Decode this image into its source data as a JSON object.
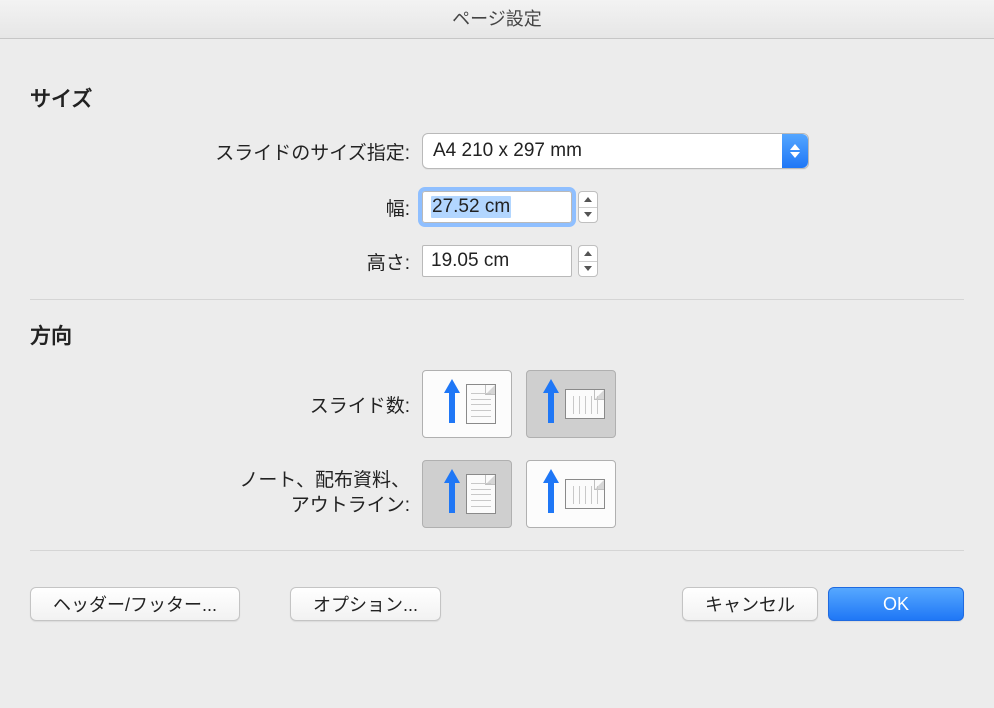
{
  "titlebar": "ページ設定",
  "sections": {
    "size": {
      "title": "サイズ",
      "slide_size_label": "スライドのサイズ指定:",
      "slide_size_value": "A4 210 x 297 mm",
      "width_label": "幅:",
      "width_value": "27.52 cm",
      "height_label": "高さ:",
      "height_value": "19.05 cm"
    },
    "orientation": {
      "title": "方向",
      "slides_label": "スライド数:",
      "notes_label_line1": "ノート、配布資料、",
      "notes_label_line2": "アウトライン:"
    }
  },
  "footer": {
    "header_footer": "ヘッダー/フッター...",
    "options": "オプション...",
    "cancel": "キャンセル",
    "ok": "OK"
  }
}
